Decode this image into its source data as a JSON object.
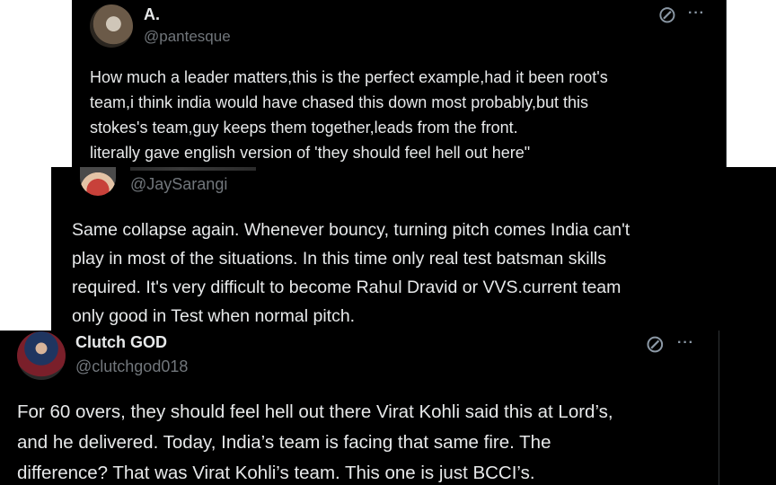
{
  "tweets": [
    {
      "name": "A.",
      "handle": "@pantesque",
      "text": "How much a leader matters,this is the perfect example,had it been root's\nteam,i think india would have chased this down most probably,but this\nstokes's team,guy keeps them together,leads from the front.\nliterally gave english version of 'they should feel hell out here\"",
      "grok_icon": "grok-slash-icon",
      "more_icon": "more-dots-icon"
    },
    {
      "name": "",
      "handle": "@JaySarangi",
      "text": "Same collapse again. Whenever bouncy,  turning pitch comes India can't\nplay in most of the situations. In this time only real test batsman skills\nrequired. It's very difficult to become Rahul Dravid or VVS.current team\nonly good in Test when normal pitch."
    },
    {
      "name": "Clutch GOD",
      "handle": "@clutchgod018",
      "text": "For 60 overs, they should feel hell out there Virat Kohli said this at Lord’s,\nand he delivered.  Today, India’s team is facing that same fire. The\ndifference? That was Virat Kohli’s team. This one is just BCCI’s.",
      "grok_icon": "grok-slash-icon",
      "more_icon": "more-dots-icon"
    }
  ],
  "colors": {
    "background": "#000000",
    "text": "#e7e9ea",
    "secondary": "#71767b"
  },
  "glyphs": {
    "grok": "⊘",
    "more": "···"
  }
}
